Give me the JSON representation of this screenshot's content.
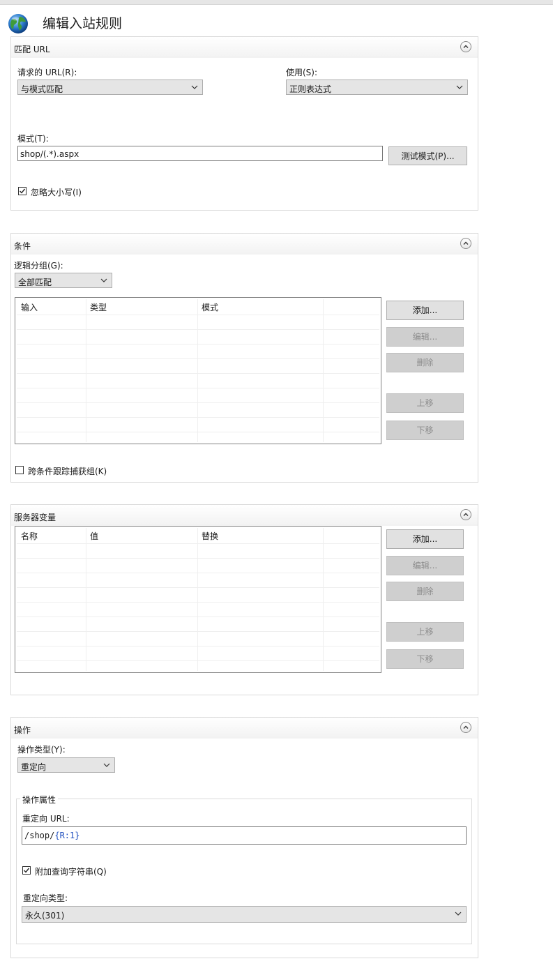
{
  "window": {
    "title": "编辑入站规则"
  },
  "match_url": {
    "section_title": "匹配 URL",
    "requested_url_label": "请求的 URL(R):",
    "requested_url_value": "与模式匹配",
    "using_label": "使用(S):",
    "using_value": "正则表达式",
    "pattern_label": "模式(T):",
    "pattern_value": "shop/(.*).aspx",
    "test_pattern_button": "测试模式(P)...",
    "ignore_case_label": "忽略大小写(I)"
  },
  "conditions": {
    "section_title": "条件",
    "logical_grouping_label": "逻辑分组(G):",
    "logical_grouping_value": "全部匹配",
    "columns": [
      "输入",
      "类型",
      "模式"
    ],
    "add_button": "添加...",
    "edit_button": "编辑...",
    "delete_button": "删除",
    "move_up_button": "上移",
    "move_down_button": "下移",
    "track_capture_label": "跨条件跟踪捕获组(K)"
  },
  "server_variables": {
    "section_title": "服务器变量",
    "columns": [
      "名称",
      "值",
      "替换"
    ],
    "add_button": "添加...",
    "edit_button": "编辑...",
    "delete_button": "删除",
    "move_up_button": "上移",
    "move_down_button": "下移"
  },
  "action": {
    "section_title": "操作",
    "action_type_label": "操作类型(Y):",
    "action_type_value": "重定向",
    "properties_group_title": "操作属性",
    "redirect_url_label": "重定向 URL:",
    "redirect_url_prefix": "/shop/",
    "redirect_url_token": "{R:1}",
    "append_query_label": "附加查询字符串(Q)",
    "redirect_type_label": "重定向类型:",
    "redirect_type_value": "永久(301)"
  },
  "colors": {
    "token_blue": "#1f4fbf",
    "disabled_text": "#8c8c8c"
  }
}
